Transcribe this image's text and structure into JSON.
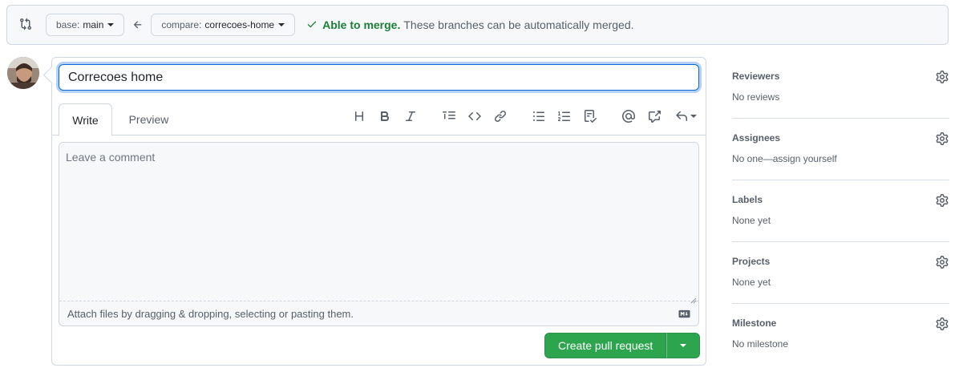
{
  "compare": {
    "base_prefix": "base:",
    "base_branch": "main",
    "compare_prefix": "compare:",
    "compare_branch": "correcoes-home",
    "merge_ok": "Able to merge.",
    "merge_desc": "These branches can be automatically merged."
  },
  "form": {
    "title_value": "Correcoes home",
    "tab_write": "Write",
    "tab_preview": "Preview",
    "comment_placeholder": "Leave a comment",
    "attach_text": "Attach files by dragging & dropping, selecting or pasting them.",
    "submit_label": "Create pull request"
  },
  "toolbar": [
    "heading-icon",
    "bold-icon",
    "italic-icon",
    "quote-icon",
    "code-icon",
    "link-icon",
    "bulleted-list-icon",
    "numbered-list-icon",
    "task-list-icon",
    "mention-icon",
    "cross-reference-icon",
    "saved-replies-icon"
  ],
  "sidebar": {
    "sections": [
      {
        "title": "Reviewers",
        "value": "No reviews"
      },
      {
        "title": "Assignees",
        "value": "No one—assign yourself"
      },
      {
        "title": "Labels",
        "value": "None yet"
      },
      {
        "title": "Projects",
        "value": "None yet"
      },
      {
        "title": "Milestone",
        "value": "No milestone"
      }
    ]
  },
  "colors": {
    "accent_blue": "#0969da",
    "success_green": "#1a7f37",
    "button_green": "#2da44e",
    "border": "#d0d7de",
    "muted_text": "#57606a"
  }
}
